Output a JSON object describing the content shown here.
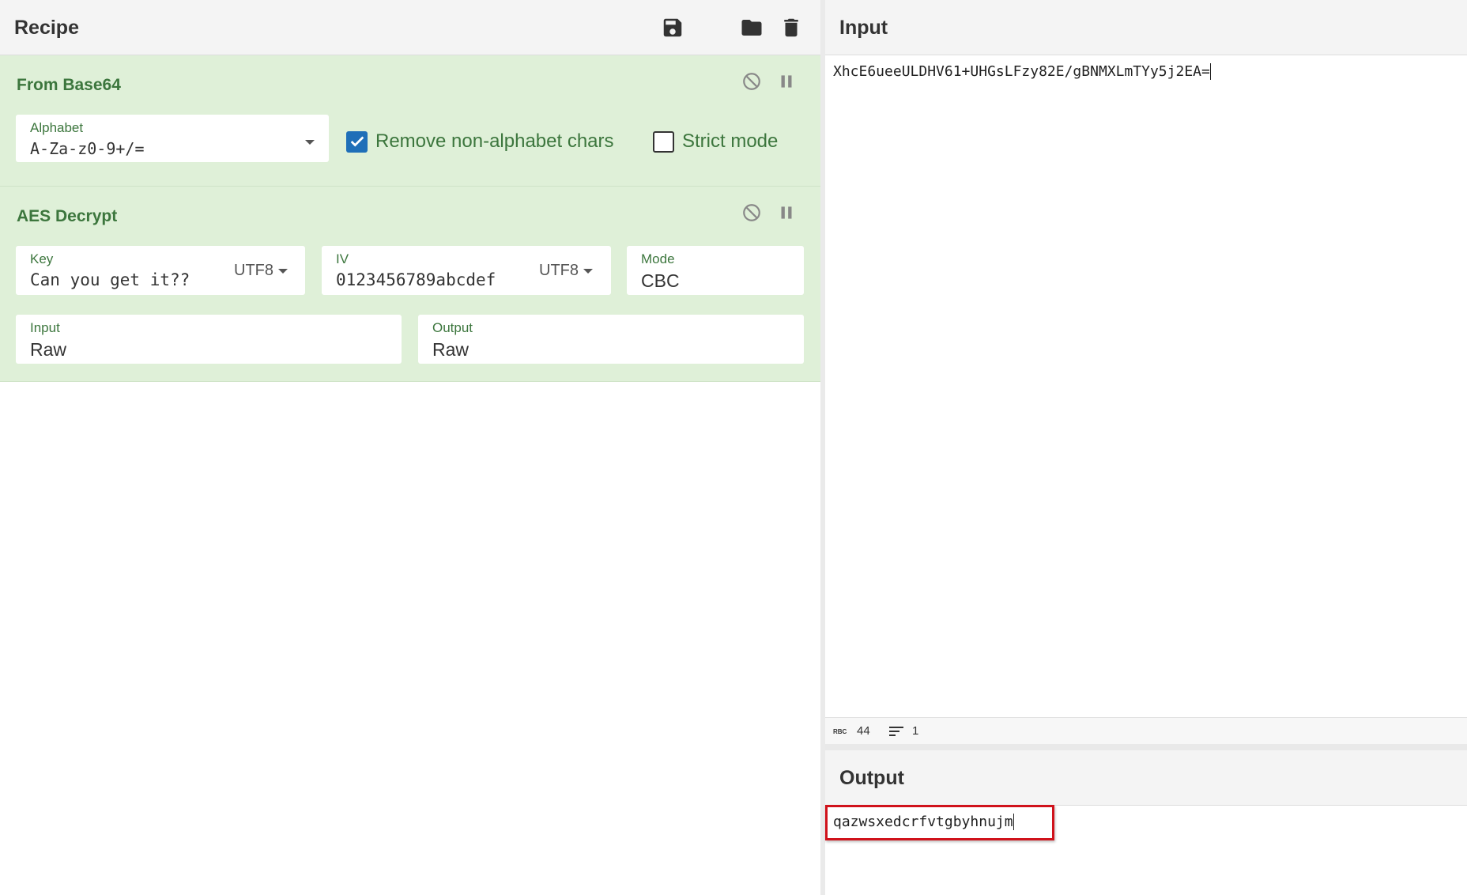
{
  "recipe": {
    "title": "Recipe",
    "toolbar": {
      "save_icon": "save-icon",
      "load_icon": "folder-icon",
      "clear_icon": "trash-icon"
    },
    "operations": [
      {
        "title": "From Base64",
        "alphabet": {
          "label": "Alphabet",
          "value": "A-Za-z0-9+/="
        },
        "remove_non_alphabet": {
          "label": "Remove non-alphabet chars",
          "checked": true
        },
        "strict_mode": {
          "label": "Strict mode",
          "checked": false
        }
      },
      {
        "title": "AES Decrypt",
        "key": {
          "label": "Key",
          "value": "Can you get it??",
          "encoding": "UTF8"
        },
        "iv": {
          "label": "IV",
          "value": "0123456789abcdef",
          "encoding": "UTF8"
        },
        "mode": {
          "label": "Mode",
          "value": "CBC"
        },
        "input": {
          "label": "Input",
          "value": "Raw"
        },
        "output": {
          "label": "Output",
          "value": "Raw"
        }
      }
    ]
  },
  "input": {
    "title": "Input",
    "text": "XhcE6ueeULDHV61+UHGsLFzy82E/gBNMXLmTYy5j2EA=",
    "status": {
      "length": "44",
      "lines": "1"
    }
  },
  "output": {
    "title": "Output",
    "text": "qazwsxedcrfvtgbyhnujm"
  },
  "colors": {
    "op_background": "#dff0d8",
    "op_text": "#3c763d",
    "highlight_border": "#d0121b",
    "checkbox_on": "#1f6fb8"
  }
}
